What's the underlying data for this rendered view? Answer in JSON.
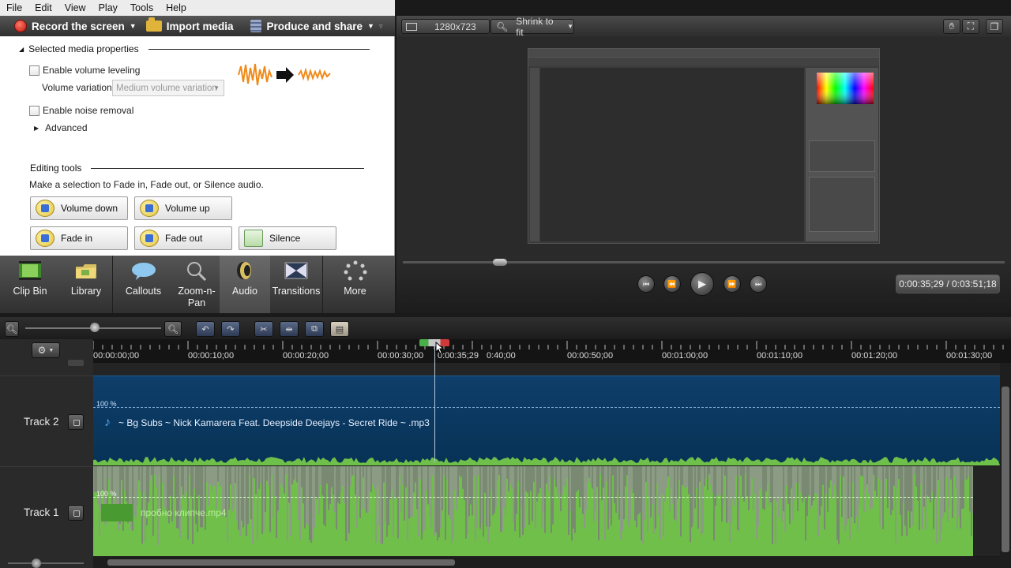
{
  "menu": [
    "File",
    "Edit",
    "View",
    "Play",
    "Tools",
    "Help"
  ],
  "toolbar": {
    "record_label": "Record the screen",
    "import_label": "Import media",
    "produce_label": "Produce and share"
  },
  "properties": {
    "section_title": "Selected media properties",
    "volume_leveling_label": "Enable volume leveling",
    "volume_variation_label": "Volume variation:",
    "volume_variation_value": "Medium volume variation",
    "noise_removal_label": "Enable noise removal",
    "advanced_label": "Advanced",
    "editing_tools_title": "Editing tools",
    "editing_instructions": "Make a selection to Fade in, Fade out, or Silence audio.",
    "buttons": {
      "volume_down": "Volume down",
      "volume_up": "Volume up",
      "fade_in": "Fade in",
      "fade_out": "Fade out",
      "silence": "Silence"
    }
  },
  "task_tabs": [
    "Clip Bin",
    "Library",
    "Callouts",
    "Zoom-n-Pan",
    "Audio",
    "Transitions",
    "More"
  ],
  "active_tab": "Audio",
  "preview": {
    "dimensions": "1280x723",
    "zoom_label": "Shrink to fit",
    "timecode": "0:00:35;29 / 0:03:51;18"
  },
  "timeline": {
    "playhead_time": "0:00:35;29",
    "ruler_labels": [
      "00:00:00;00",
      "00:00:10;00",
      "00:00:20;00",
      "00:00:30;00",
      "0:40;00",
      "00:00:50;00",
      "00:01:00;00",
      "00:01:10;00",
      "00:01:20;00",
      "00:01:30;00"
    ],
    "tracks": [
      {
        "name": "Track 2",
        "clip": "~ Bg Subs ~ Nick Kamarera Feat. Deepside Deejays - Secret Ride ~ .mp3",
        "volume": "100 %"
      },
      {
        "name": "Track 1",
        "clip": "пробно клипче.mp4",
        "volume": "100 %"
      }
    ]
  },
  "colors": {
    "audio_track_blue": "#0e3e6a",
    "video_track_green": "#6fbf4a",
    "record_red": "#c0160a"
  }
}
